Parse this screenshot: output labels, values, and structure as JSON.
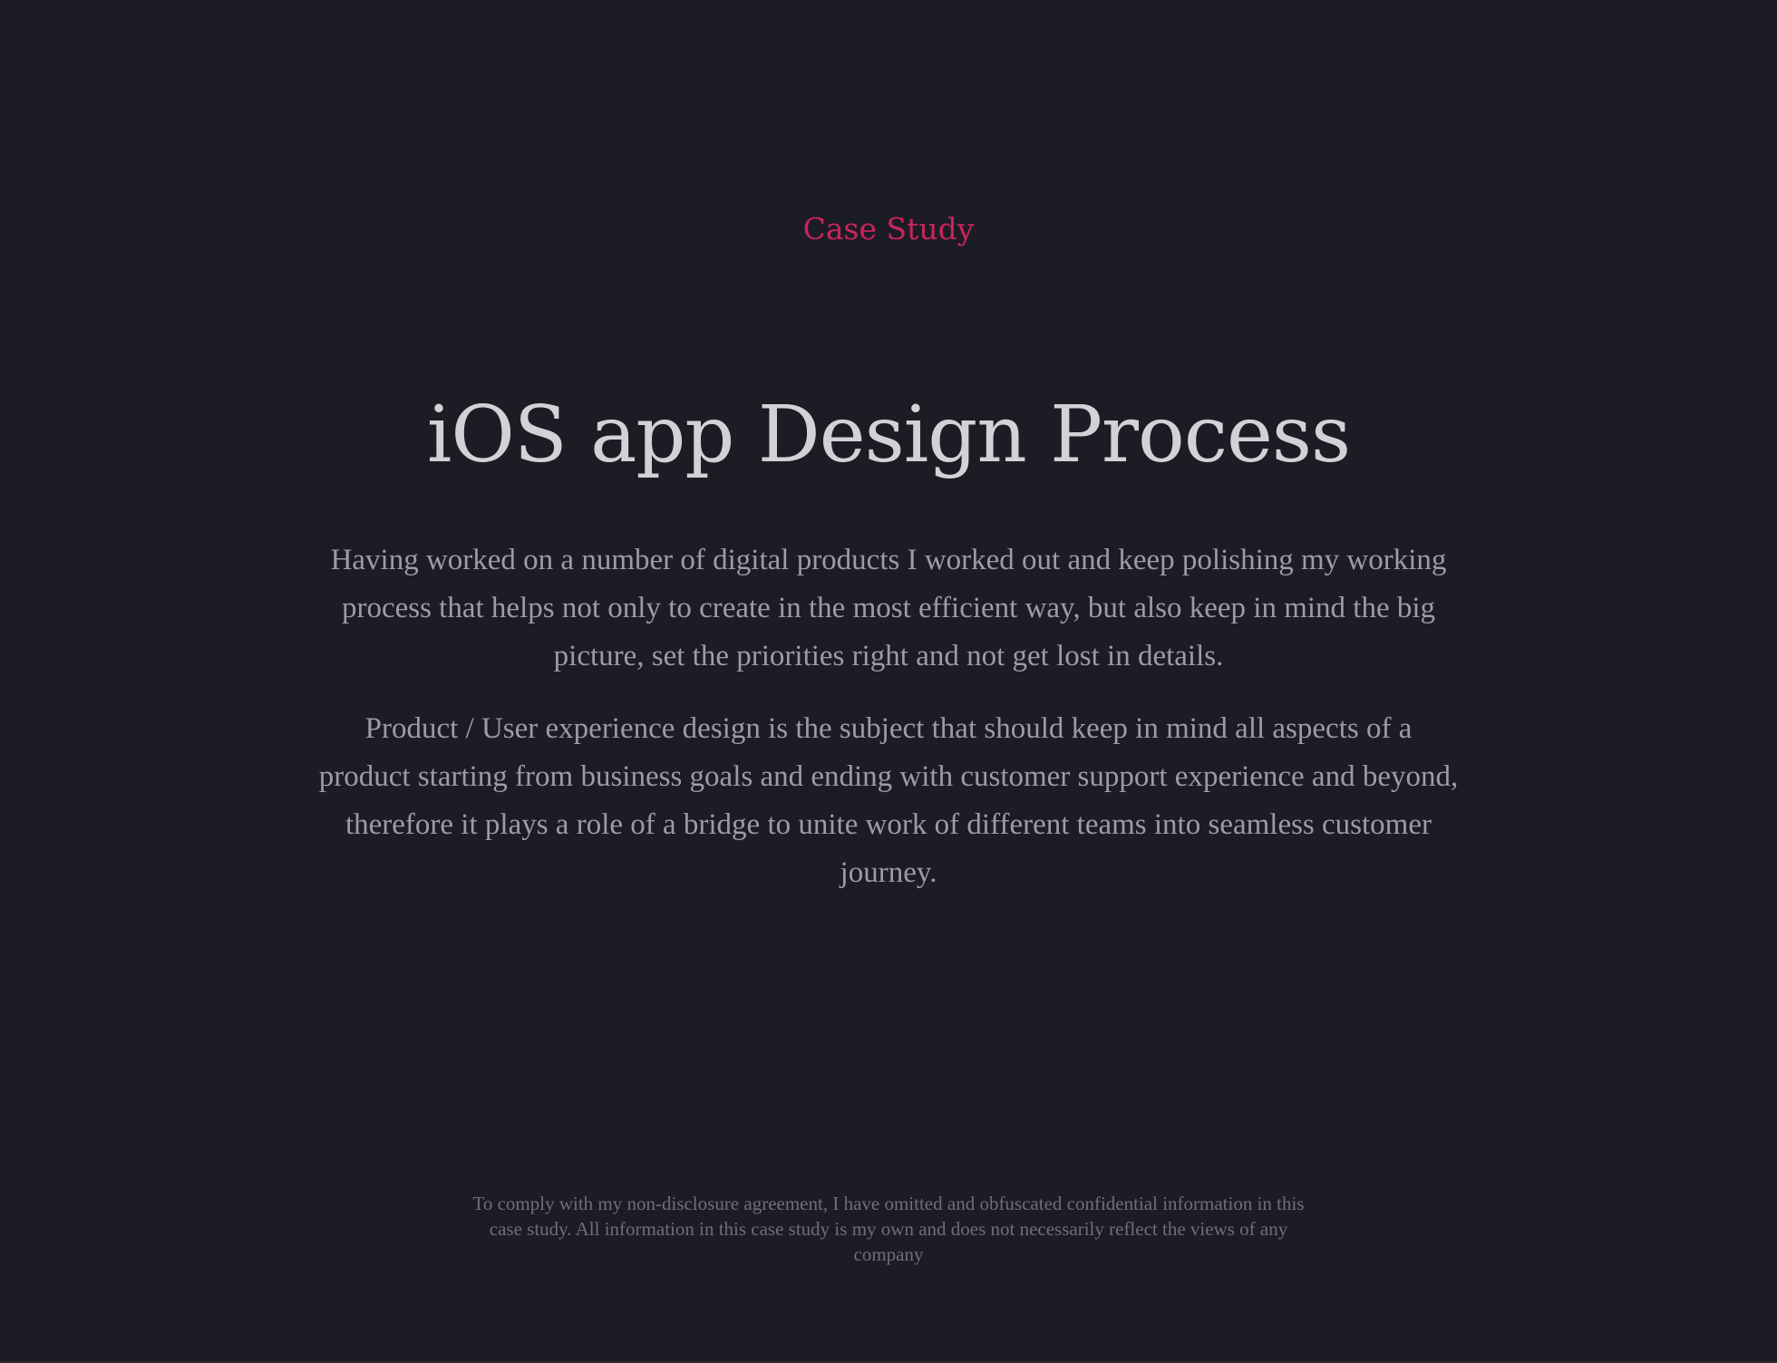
{
  "hero": {
    "eyebrow": "Case Study",
    "title": "iOS app Design Process",
    "paragraphs": [
      "Having worked on a number of digital products I worked out and keep polishing my working process that helps not only to create in the most efficient way, but also keep in mind the big picture, set the priorities right and not get lost in details.",
      "Product / User experience design is the subject that should keep in mind all aspects of a product starting from business goals and ending with customer support experience and beyond, therefore it plays a role of a bridge  to unite work of different teams into seamless customer journey."
    ]
  },
  "footer": {
    "disclaimer": "To comply with my non-disclosure agreement, I have omitted and obfuscated confidential information in this case study. All information in this case study is my own and does not necessarily reflect the views of any company"
  },
  "colors": {
    "background": "#1c1c25",
    "accent": "#c8245f",
    "title": "#d2d2d6",
    "body_text": "#9c9ca8",
    "muted_text": "#6f6f7b"
  }
}
